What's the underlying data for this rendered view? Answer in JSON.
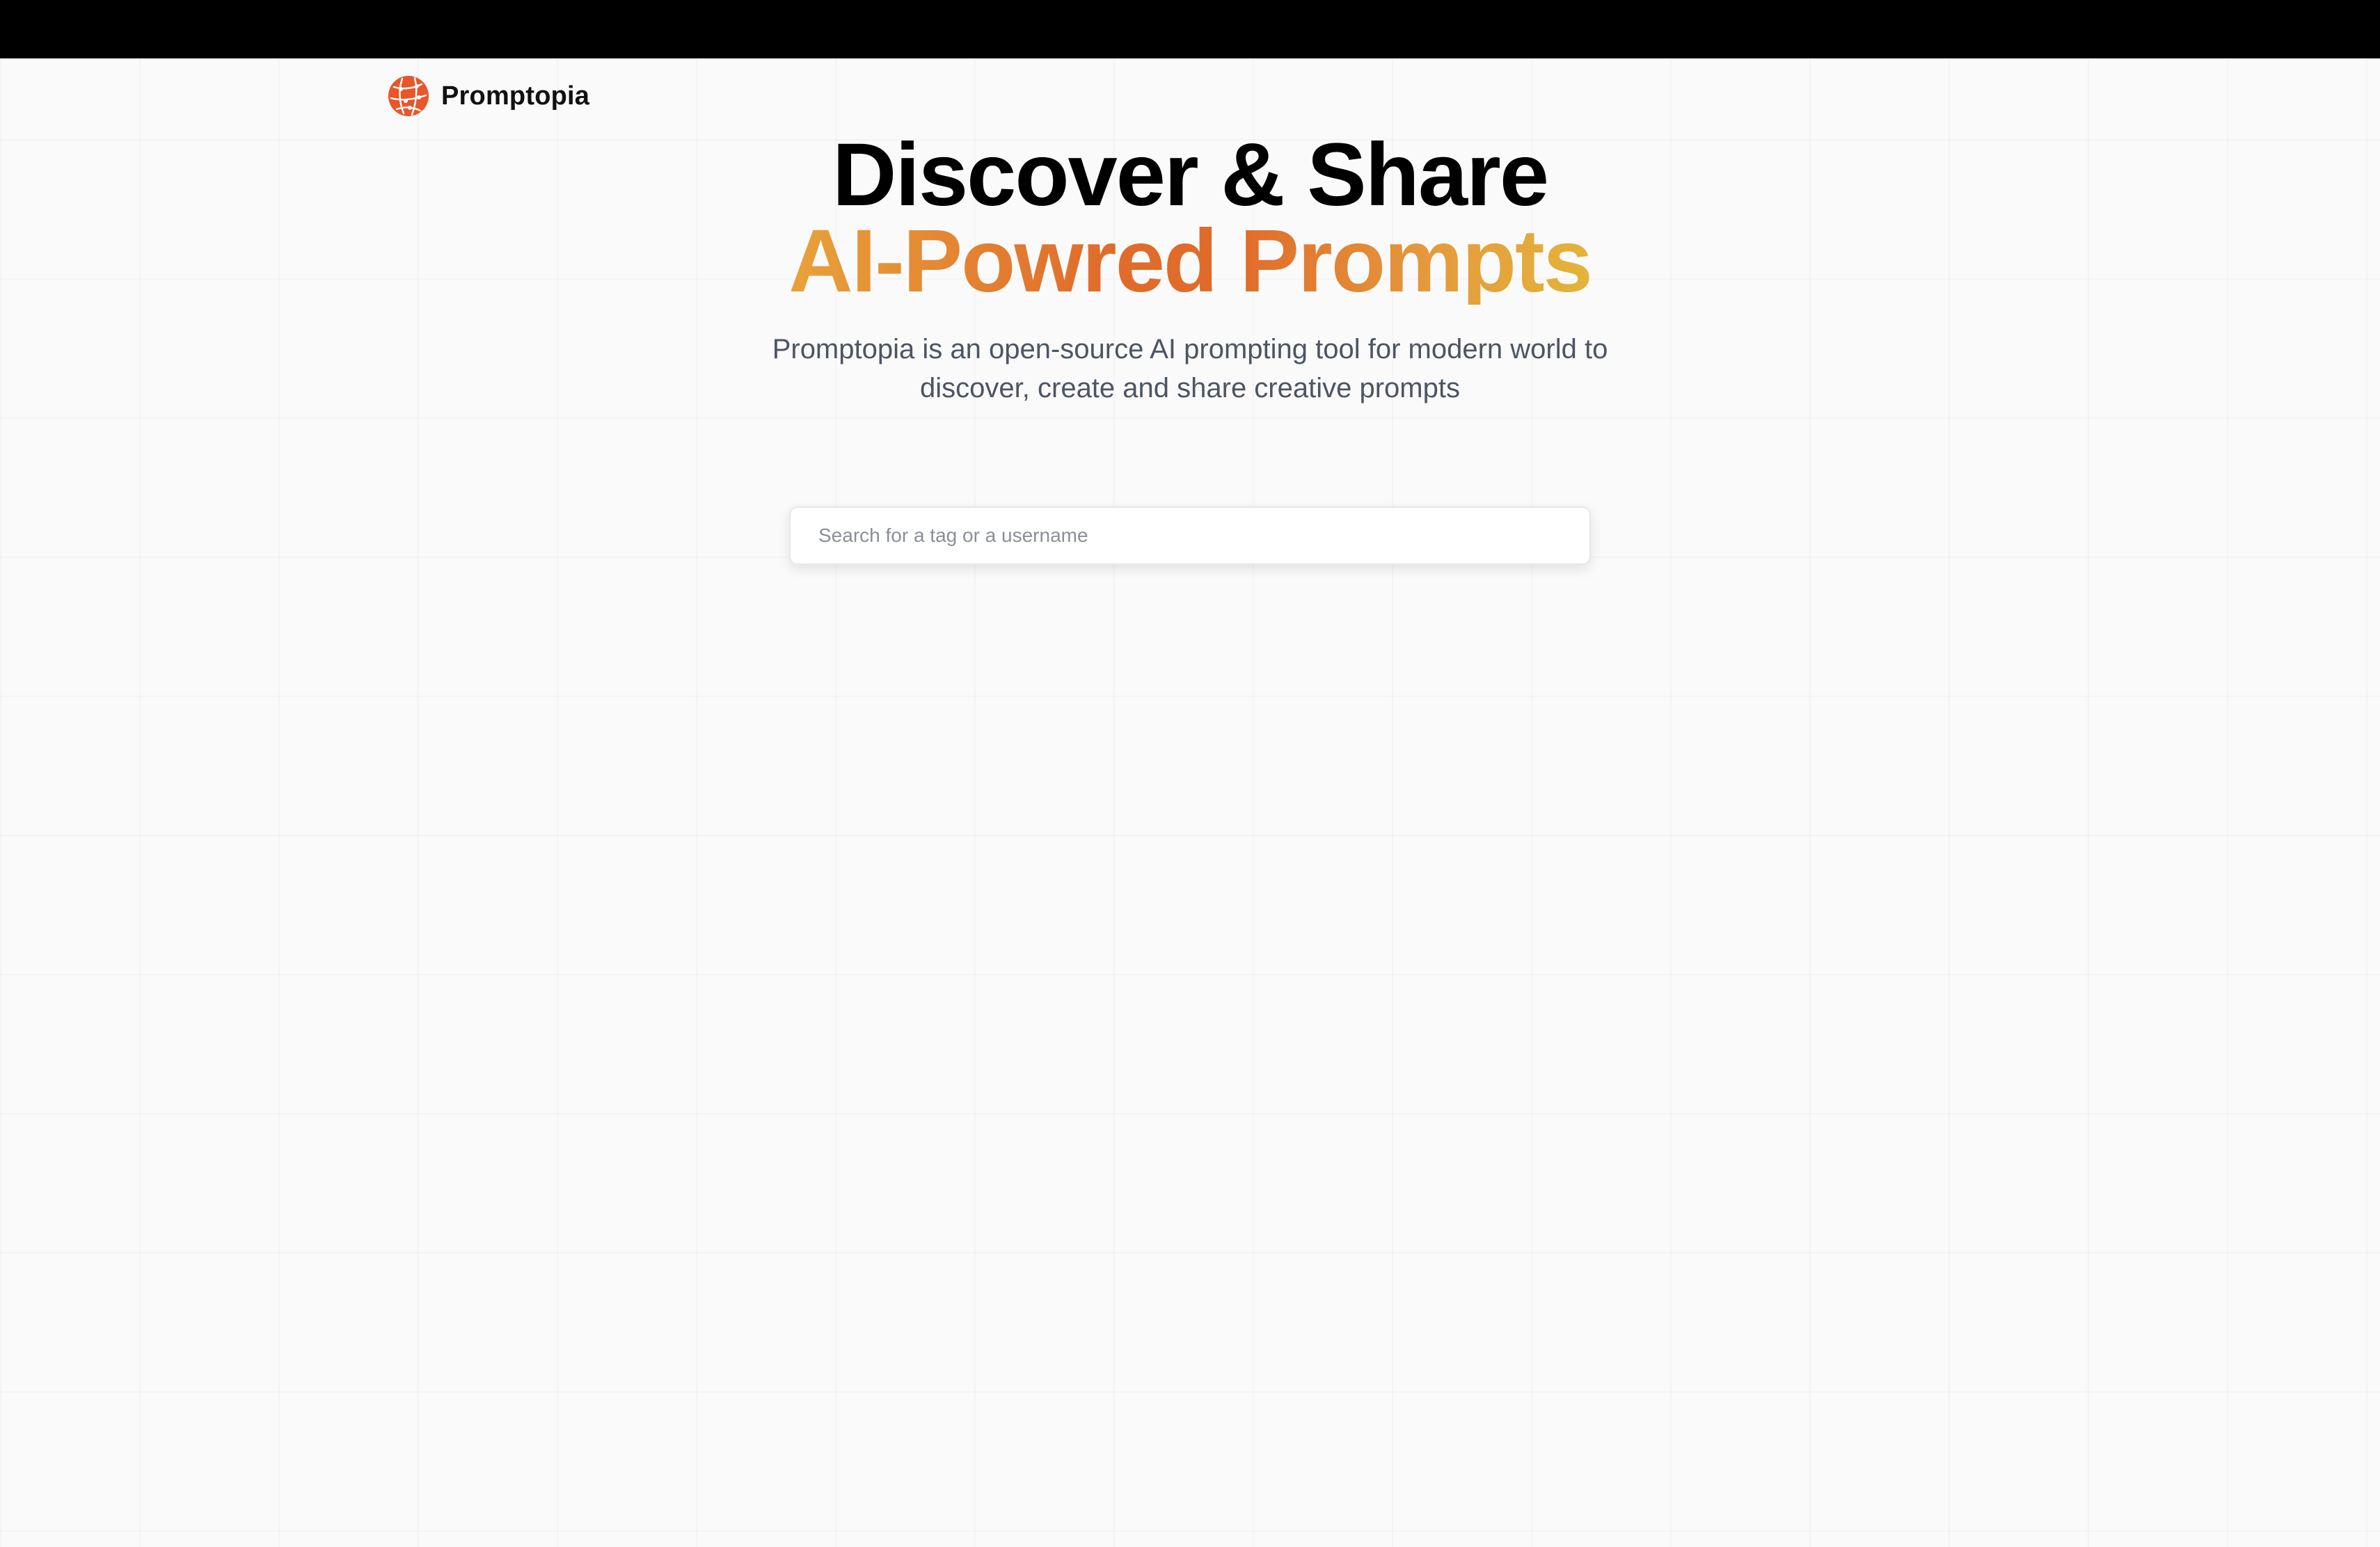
{
  "brand": {
    "name": "Promptopia",
    "logo_icon": "globe-network-logo-icon",
    "logo_color": "#e8562a"
  },
  "hero": {
    "headline_line1": "Discover & Share",
    "headline_line2": "AI-Powred Prompts",
    "subtitle": "Promptopia is an open-source AI prompting tool for modern world to discover, create and share creative prompts",
    "accent_gradient": [
      "#e8a23a",
      "#e06d2c",
      "#e3b43a"
    ]
  },
  "search": {
    "placeholder": "Search for a tag or a username",
    "value": ""
  },
  "colors": {
    "background": "#fafafa",
    "top_bar": "#000000",
    "headline": "#000000",
    "subtitle": "#4b5563"
  }
}
